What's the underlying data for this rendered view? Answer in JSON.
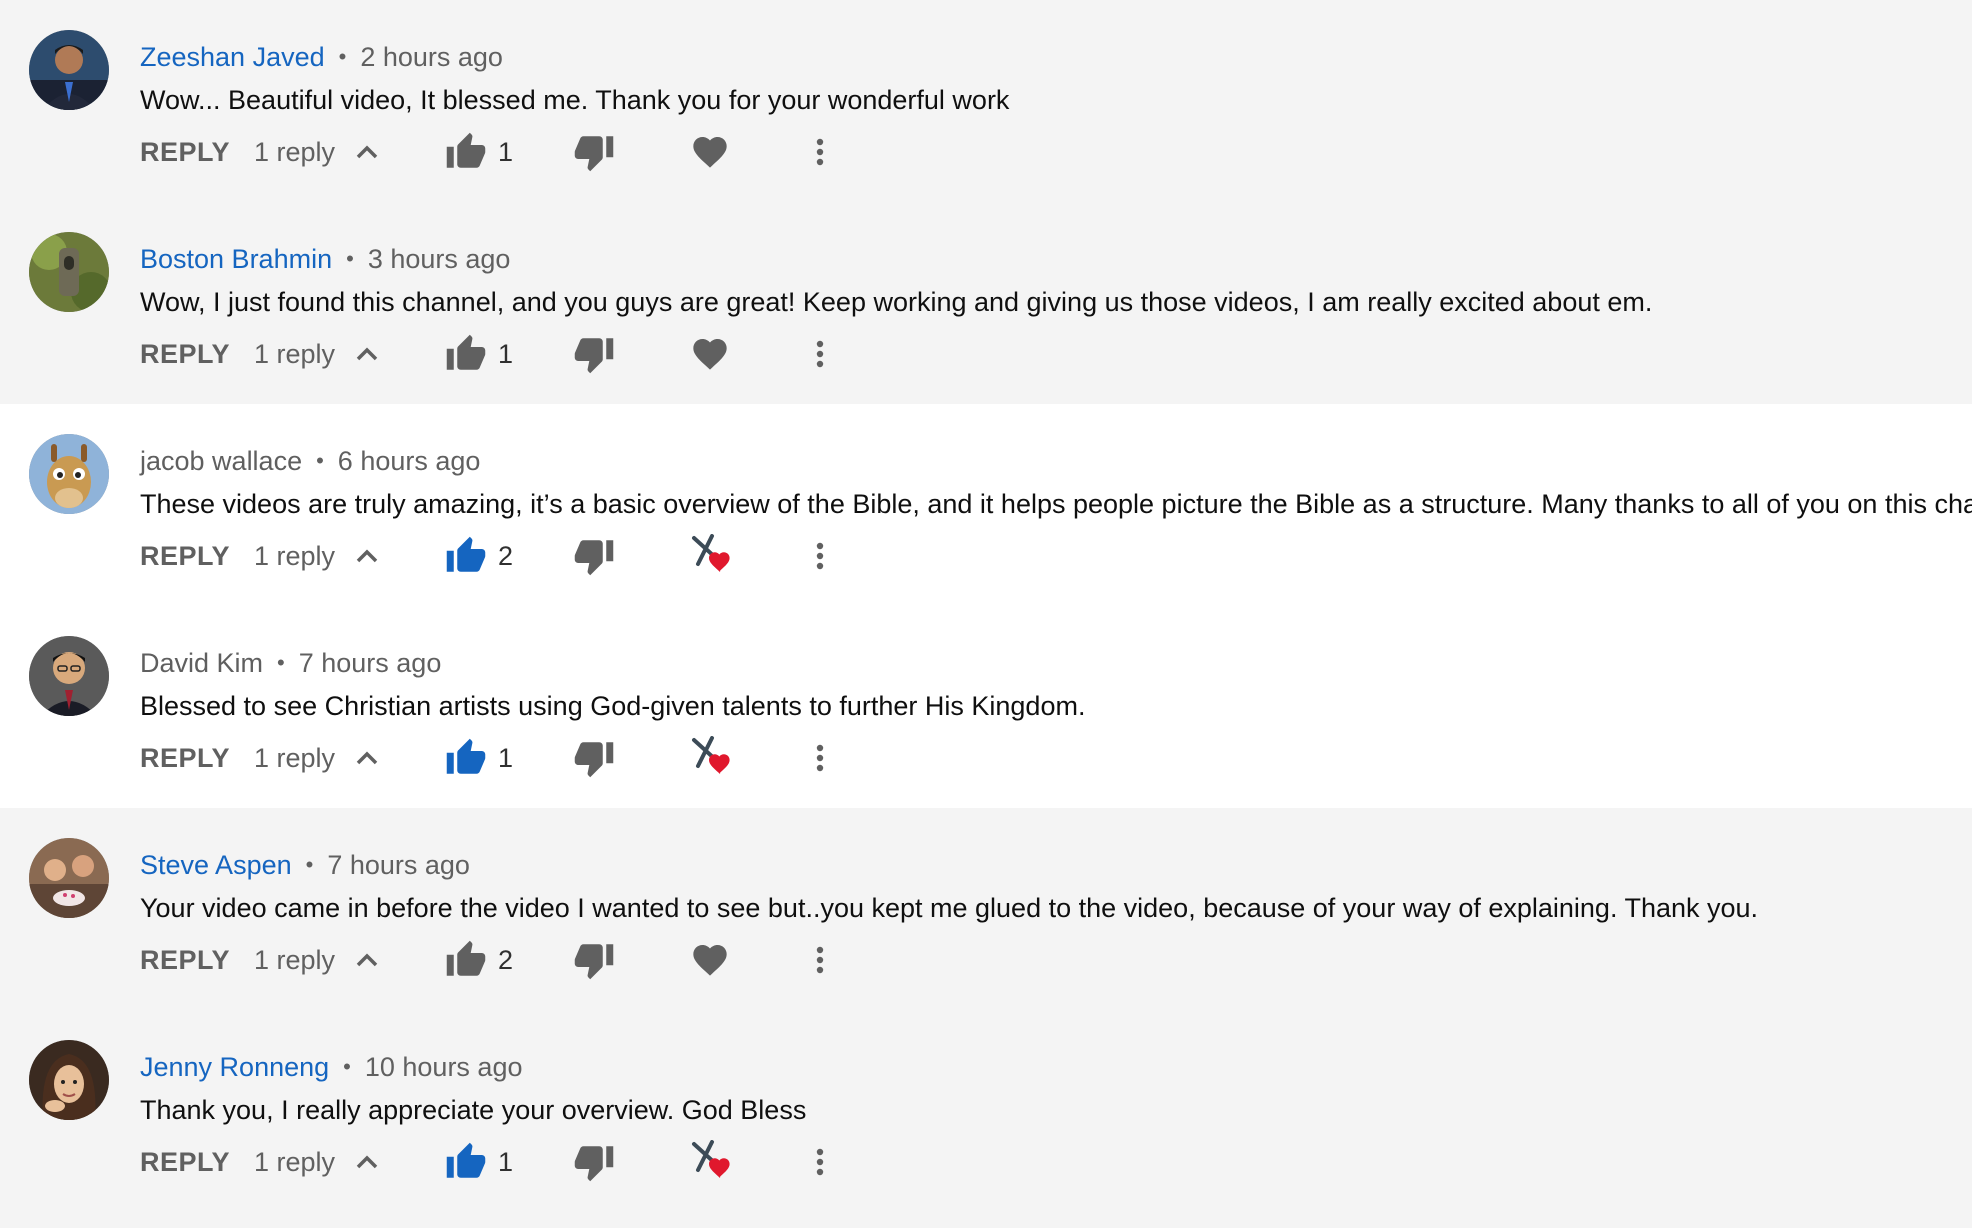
{
  "comments": [
    {
      "author": "Zeeshan Javed",
      "time": "2 hours ago",
      "text": "Wow... Beautiful video, It blessed me. Thank you for your wonderful work",
      "reply_label": "REPLY",
      "replies": "1 reply",
      "likes": "1",
      "liked": false,
      "hearted_by_creator": false
    },
    {
      "author": "Boston Brahmin",
      "time": "3 hours ago",
      "text": "Wow, I just found this channel, and you guys are great! Keep working and giving us those videos, I am really excited about em.",
      "reply_label": "REPLY",
      "replies": "1 reply",
      "likes": "1",
      "liked": false,
      "hearted_by_creator": false
    },
    {
      "author": "jacob wallace",
      "time": "6 hours ago",
      "text": "These videos are truly amazing, it’s a basic overview of the Bible, and it helps people picture the Bible as a structure. Many thanks to all of you on this channel",
      "reply_label": "REPLY",
      "replies": "1 reply",
      "likes": "2",
      "liked": true,
      "hearted_by_creator": true
    },
    {
      "author": "David Kim",
      "time": "7 hours ago",
      "text": "Blessed to see Christian artists using God-given talents to further His Kingdom.",
      "reply_label": "REPLY",
      "replies": "1 reply",
      "likes": "1",
      "liked": true,
      "hearted_by_creator": true
    },
    {
      "author": "Steve Aspen",
      "time": "7 hours ago",
      "text": "Your video came in before the video I wanted to see but..you kept me glued to the video, because of your way of explaining.  Thank you.",
      "reply_label": "REPLY",
      "replies": "1 reply",
      "likes": "2",
      "liked": false,
      "hearted_by_creator": false
    },
    {
      "author": "Jenny Ronneng",
      "time": "10 hours ago",
      "text": "Thank you, I really appreciate your overview. God Bless",
      "reply_label": "REPLY",
      "replies": "1 reply",
      "likes": "1",
      "liked": true,
      "hearted_by_creator": true
    }
  ],
  "colors": {
    "author_link": "#1565c0",
    "like_active": "#1565c0",
    "icon_inactive": "#606060",
    "creator_heart": "#e0182d"
  }
}
